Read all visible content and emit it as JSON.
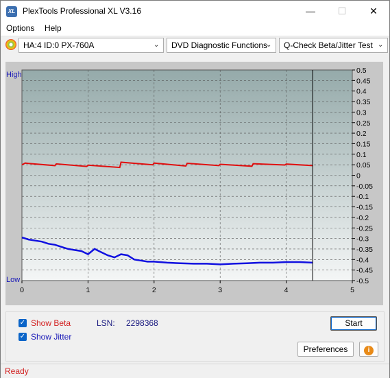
{
  "window": {
    "title": "PlexTools Professional XL V3.16",
    "logo_text": "XL",
    "min": "—",
    "max": "☐",
    "close": "✕"
  },
  "menu": [
    "Options",
    "Help"
  ],
  "toolbar": {
    "drive": "HA:4 ID:0  PX-760A",
    "function": "DVD Diagnostic Functions",
    "test": "Q-Check Beta/Jitter Test",
    "arrow": "⌄"
  },
  "chart_data": {
    "type": "line",
    "xlabel": "",
    "ylabel": "",
    "xlim": [
      0,
      5
    ],
    "ylim": [
      -0.5,
      0.5
    ],
    "x_ticks": [
      "0",
      "1",
      "2",
      "3",
      "4",
      "5"
    ],
    "y_ticks": [
      "0.5",
      "0.45",
      "0.4",
      "0.35",
      "0.3",
      "0.25",
      "0.2",
      "0.15",
      "0.1",
      "0.05",
      "0",
      "-0.05",
      "-0.1",
      "-0.15",
      "-0.2",
      "-0.25",
      "-0.3",
      "-0.35",
      "-0.4",
      "-0.45",
      "-0.5"
    ],
    "high_label": "High",
    "low_label": "Low",
    "end_marker_x": 4.4,
    "grid": true,
    "series": [
      {
        "name": "Beta",
        "color": "#e01010",
        "x": [
          0,
          0.05,
          0.1,
          0.5,
          0.52,
          0.98,
          1.0,
          1.48,
          1.5,
          1.98,
          2.0,
          2.48,
          2.5,
          2.98,
          3.0,
          3.48,
          3.5,
          3.98,
          4.0,
          4.4
        ],
        "y": [
          0.05,
          0.058,
          0.056,
          0.046,
          0.054,
          0.042,
          0.048,
          0.037,
          0.062,
          0.05,
          0.058,
          0.044,
          0.057,
          0.046,
          0.052,
          0.043,
          0.055,
          0.049,
          0.053,
          0.046
        ]
      },
      {
        "name": "Jitter",
        "color": "#1010e0",
        "x": [
          0,
          0.1,
          0.2,
          0.3,
          0.4,
          0.5,
          0.6,
          0.7,
          0.8,
          0.9,
          1.0,
          1.1,
          1.2,
          1.3,
          1.4,
          1.5,
          1.6,
          1.7,
          1.8,
          1.9,
          2.0,
          2.2,
          2.4,
          2.6,
          2.8,
          3.0,
          3.2,
          3.4,
          3.6,
          3.8,
          4.0,
          4.2,
          4.4
        ],
        "y": [
          -0.295,
          -0.305,
          -0.31,
          -0.315,
          -0.325,
          -0.33,
          -0.34,
          -0.35,
          -0.355,
          -0.36,
          -0.375,
          -0.35,
          -0.365,
          -0.38,
          -0.39,
          -0.375,
          -0.38,
          -0.4,
          -0.405,
          -0.41,
          -0.41,
          -0.415,
          -0.418,
          -0.42,
          -0.42,
          -0.423,
          -0.42,
          -0.418,
          -0.415,
          -0.415,
          -0.412,
          -0.412,
          -0.415
        ]
      }
    ]
  },
  "bottom": {
    "show_beta": "Show Beta",
    "show_jitter": "Show Jitter",
    "lsn_label": "LSN:",
    "lsn_value": "2298368",
    "start": "Start",
    "preferences": "Preferences",
    "info_icon": "i",
    "check": "✓"
  },
  "status": "Ready",
  "colors": {
    "beta": "#e01010",
    "jitter": "#1010e0",
    "accent": "#0a64c8"
  }
}
